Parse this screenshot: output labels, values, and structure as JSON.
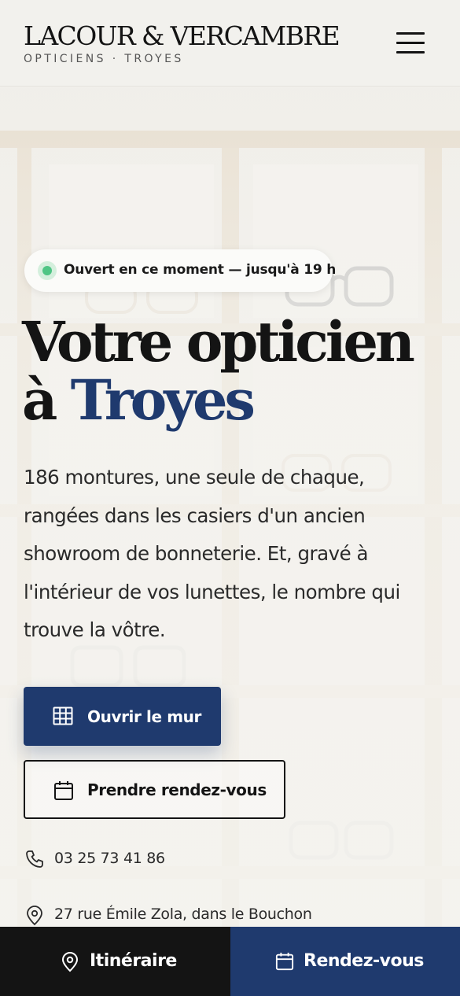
{
  "header": {
    "brand": "LACOUR & VERCAMBRE",
    "tagline": "OPTICIENS · TROYES",
    "menu_icon": "hamburger-menu-icon"
  },
  "hero": {
    "status": "Ouvert en ce moment — jusqu'à 19 h",
    "status_color": "#4fc585",
    "title_line1": "Votre opticien",
    "title_prefix": "à",
    "title_accent": "Troyes",
    "description": "186 montures, une seule de chaque, rangées dans les casiers d'un ancien showroom de bonneterie. Et, gravé à l'intérieur de vos lunettes, le nombre qui trouve la vôtre.",
    "primary_button": "Ouvrir le mur",
    "primary_icon": "grid-icon",
    "secondary_button": "Prendre rendez-vous",
    "secondary_icon": "calendar-icon",
    "phone": "03 25 73 41 86",
    "phone_icon": "phone-icon",
    "address": "27 rue Émile Zola, dans le Bouchon",
    "address_icon": "map-pin-icon"
  },
  "bottom_bar": {
    "left_label": "Itinéraire",
    "left_icon": "map-pin-icon",
    "right_label": "Rendez-vous",
    "right_icon": "calendar-icon"
  },
  "colors": {
    "accent": "#1f3a6e",
    "dark": "#141414",
    "background": "#f3f2ee"
  }
}
